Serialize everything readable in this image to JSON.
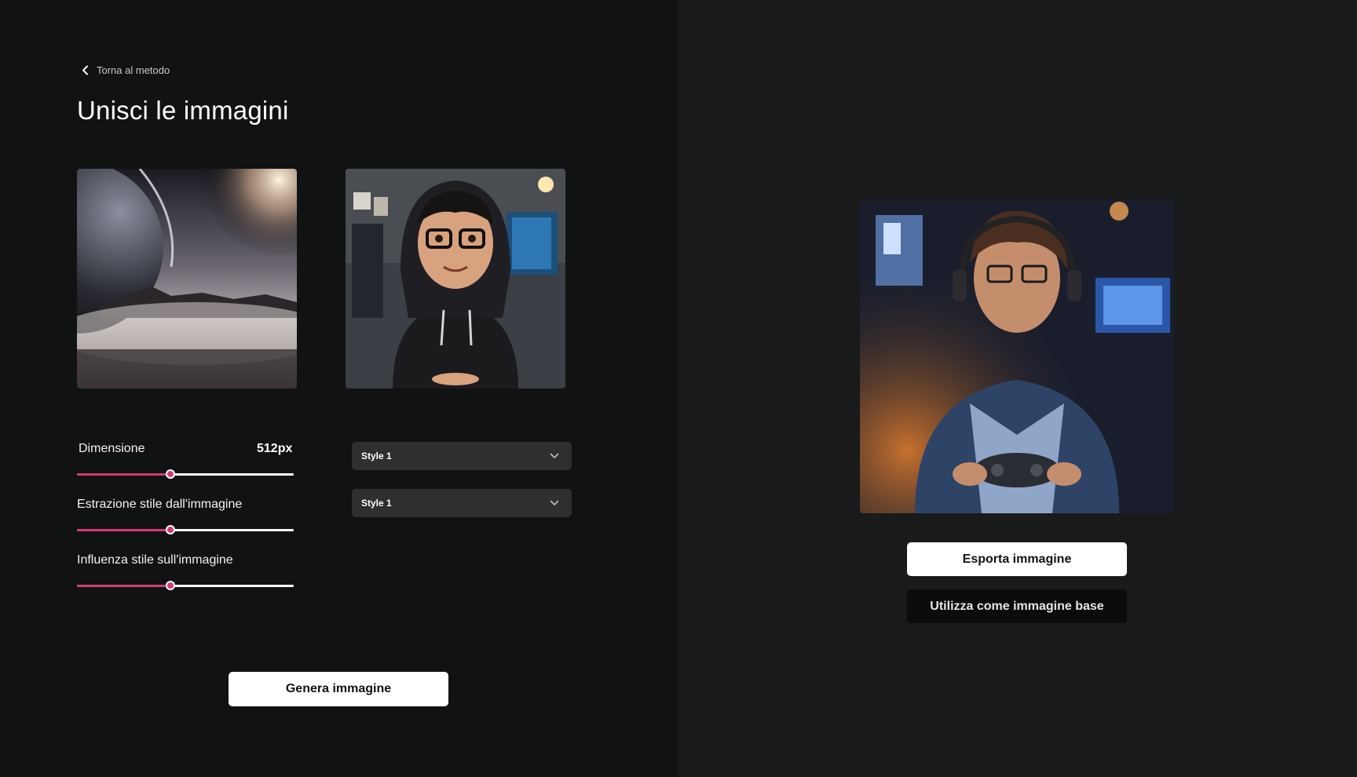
{
  "nav": {
    "back_label": "Torna al metodo"
  },
  "page": {
    "title": "Unisci le immagini"
  },
  "images": {
    "source_1": {
      "alt": "Paesaggio planetario"
    },
    "source_2": {
      "alt": "Personaggio con felpa e occhiali"
    },
    "result": {
      "alt": "Immagine generata"
    }
  },
  "controls": {
    "dimension": {
      "label": "Dimensione",
      "value": "512px",
      "level": 0.43
    },
    "style_extraction": {
      "label": "Estrazione stile dall'immagine",
      "level": 0.43
    },
    "style_influence": {
      "label": "Influenza stile sull'immagine",
      "level": 0.43
    }
  },
  "selects": {
    "style_1": {
      "selected": "Style 1"
    },
    "style_2": {
      "selected": "Style 1"
    }
  },
  "actions": {
    "generate_label": "Genera immagine",
    "export_label": "Esporta immagine",
    "use_as_base_label": "Utilizza come immagine base"
  },
  "colors": {
    "accent": "#d23c74",
    "left_bg": "#111212",
    "right_bg": "#191a1a",
    "select_bg": "#2e2f31"
  },
  "icons": {
    "back": "chevron-left-icon",
    "dropdown": "chevron-down-icon"
  }
}
